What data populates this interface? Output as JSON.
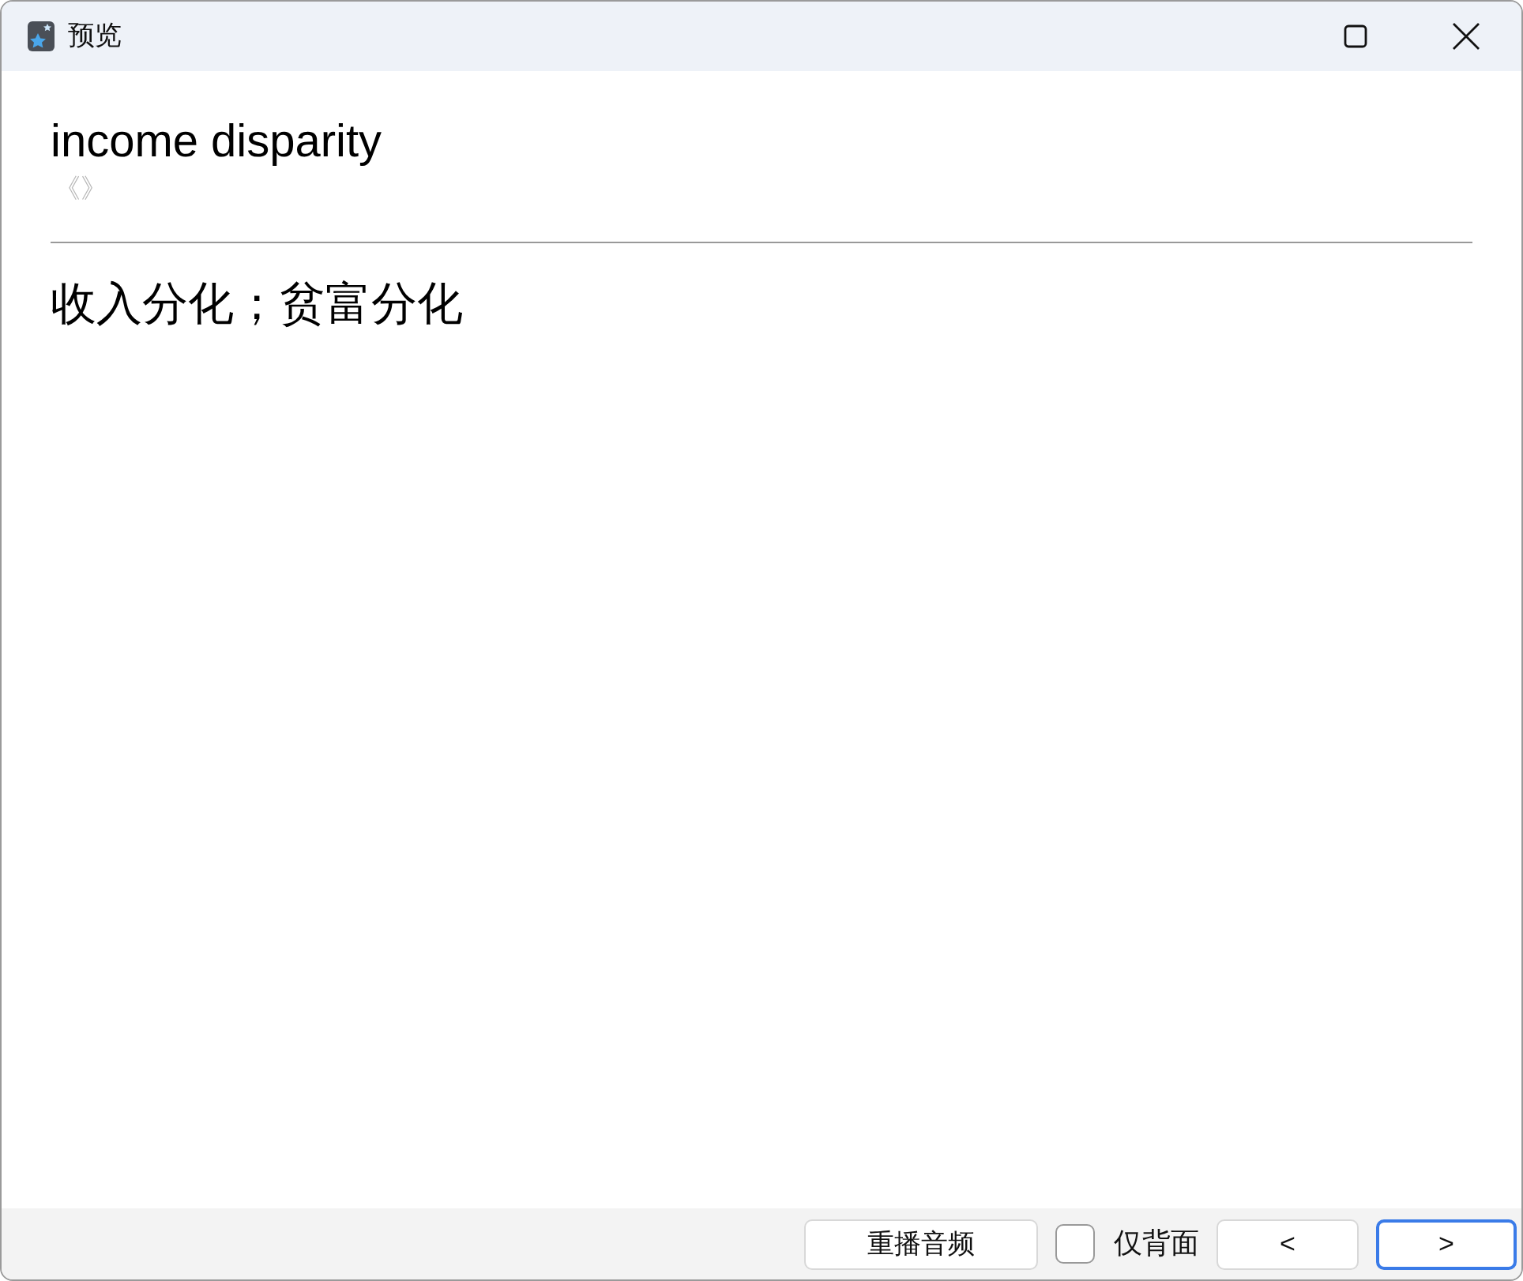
{
  "window": {
    "title": "预览"
  },
  "entry": {
    "term": "income disparity",
    "pronunciation": "《》",
    "definition": "收入分化；贫富分化"
  },
  "footer": {
    "replay_button": {
      "label": "重播音频",
      "focused": false
    },
    "back_only": {
      "label": "仅背面",
      "checked": false
    },
    "prev_button": {
      "label": "<",
      "focused": false
    },
    "next_button": {
      "label": ">",
      "focused": true
    }
  }
}
